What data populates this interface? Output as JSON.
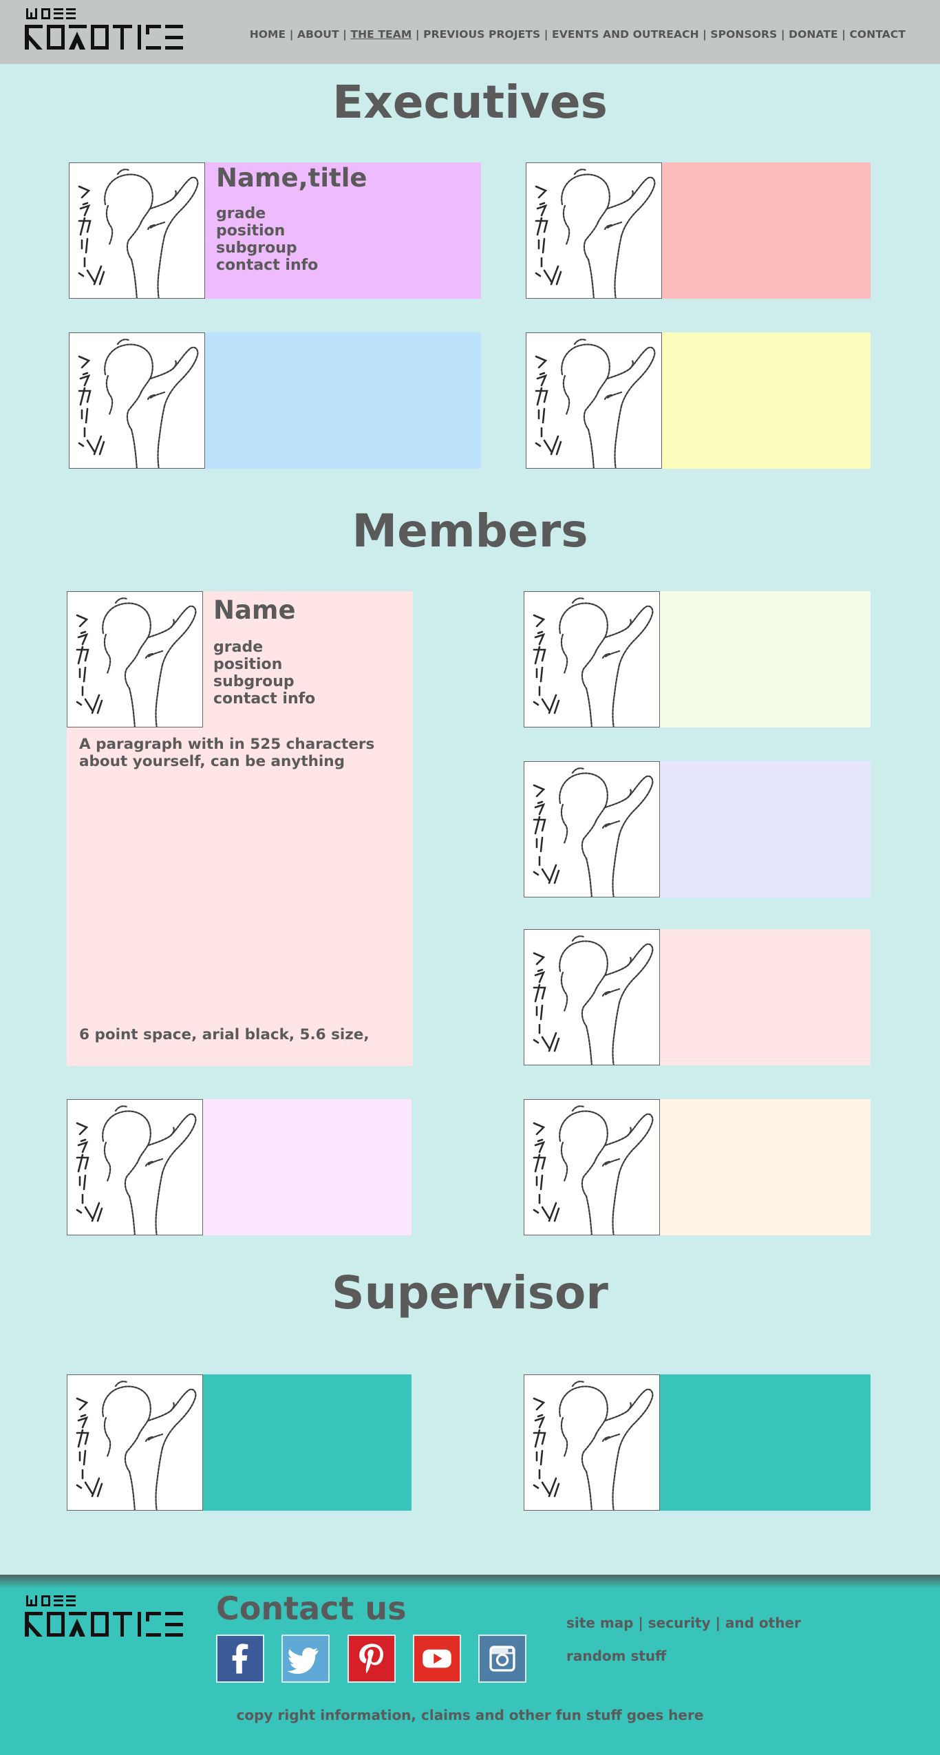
{
  "colors": {
    "header_bg": "#c3c6c6",
    "page_bg": "#ccedeb",
    "footer_bg": "#38c4ba",
    "text": "#5a5a5a"
  },
  "header": {
    "logo_icon": "robotics-logo",
    "nav": [
      {
        "label": "HOME"
      },
      {
        "label": "ABOUT"
      },
      {
        "label": "THE TEAM",
        "active": true
      },
      {
        "label": "PREVIOUS PROJETS"
      },
      {
        "label": "EVENTS AND OUTREACH"
      },
      {
        "label": "SPONSORS"
      },
      {
        "label": "DONATE"
      },
      {
        "label": "CONTACT"
      }
    ],
    "separator": "|"
  },
  "executives": {
    "title": "Executives",
    "cards": [
      {
        "color": "#eebcfd",
        "name": "Name,title",
        "details": [
          "grade",
          "position",
          "subgroup",
          "contact info"
        ]
      },
      {
        "color": "#fdbcbc"
      },
      {
        "color": "#bde2fb"
      },
      {
        "color": "#fcfdbc"
      }
    ]
  },
  "members": {
    "title": "Members",
    "featured": {
      "color": "#ffe5e6",
      "name": "Name",
      "details": [
        "grade",
        "position",
        "subgroup",
        "contact info"
      ],
      "paragraph": "A paragraph with in 525 characters about yourself, can be anything",
      "note": "6 point space, arial black, 5.6 size,"
    },
    "cards": [
      {
        "color": "#f3fde7"
      },
      {
        "color": "#e6e6fe"
      },
      {
        "color": "#ffe5e6"
      },
      {
        "color": "#fbe6fe"
      },
      {
        "color": "#fff2e6"
      }
    ]
  },
  "supervisor": {
    "title": "Supervisor",
    "cards": [
      {
        "color": "#38c4ba"
      },
      {
        "color": "#38c4ba"
      }
    ]
  },
  "footer": {
    "logo_icon": "robotics-logo",
    "contact_title": "Contact us",
    "social": [
      {
        "icon": "facebook-icon",
        "color": "#3a5a98"
      },
      {
        "icon": "twitter-icon",
        "color": "#5ea9d6"
      },
      {
        "icon": "pinterest-icon",
        "color": "#d61f26"
      },
      {
        "icon": "youtube-icon",
        "color": "#e22d24"
      },
      {
        "icon": "instagram-icon",
        "color": "#4e7ea6"
      }
    ],
    "links": [
      "site map",
      "security",
      "and other"
    ],
    "links_line2": "random stuff",
    "copyright": "copy right information, claims and other fun stuff goes here"
  }
}
